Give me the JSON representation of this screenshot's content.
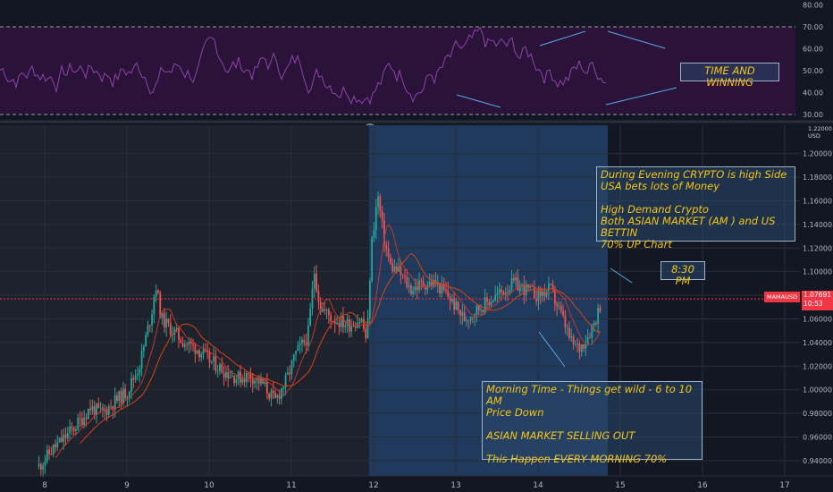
{
  "chart_data": [
    {
      "type": "line",
      "name": "oscillator",
      "y_ticks": [
        "80.00",
        "70.00",
        "60.00",
        "50.00",
        "40.00",
        "30.00"
      ],
      "upper_band": 70,
      "lower_band": 30,
      "ylim": [
        25,
        83
      ],
      "colors": {
        "line": "#8e44ad",
        "band_fill": "#2a1238",
        "band_line": "#9e9e9e"
      }
    },
    {
      "type": "candlestick",
      "name": "price",
      "currency": "USD",
      "y_ticks": [
        "1.22000",
        "1.20000",
        "1.18000",
        "1.16000",
        "1.14000",
        "1.12000",
        "1.10000",
        "1.08000",
        "1.06000",
        "1.04000",
        "1.02000",
        "1.00000",
        "0.98000",
        "0.96000",
        "0.94000"
      ],
      "ylim": [
        0.927,
        1.224
      ],
      "x_ticks": [
        "8",
        "9",
        "10",
        "11",
        "12",
        "13",
        "14",
        "15",
        "16",
        "17"
      ],
      "close_points": [
        [
          7.93,
          0.935
        ],
        [
          8.1,
          0.95
        ],
        [
          8.25,
          0.96
        ],
        [
          8.45,
          0.975
        ],
        [
          8.55,
          0.985
        ],
        [
          8.7,
          0.98
        ],
        [
          8.85,
          0.99
        ],
        [
          9.0,
          0.998
        ],
        [
          9.15,
          1.02
        ],
        [
          9.3,
          1.065
        ],
        [
          9.35,
          1.09
        ],
        [
          9.42,
          1.06
        ],
        [
          9.55,
          1.05
        ],
        [
          9.7,
          1.04
        ],
        [
          9.85,
          1.035
        ],
        [
          10.0,
          1.025
        ],
        [
          10.2,
          1.015
        ],
        [
          10.35,
          1.01
        ],
        [
          10.5,
          1.012
        ],
        [
          10.65,
          1.005
        ],
        [
          10.8,
          0.99
        ],
        [
          10.95,
          1.01
        ],
        [
          11.05,
          1.03
        ],
        [
          11.2,
          1.045
        ],
        [
          11.28,
          1.1
        ],
        [
          11.35,
          1.07
        ],
        [
          11.5,
          1.06
        ],
        [
          11.7,
          1.055
        ],
        [
          11.85,
          1.06
        ],
        [
          11.92,
          1.04
        ],
        [
          11.97,
          1.12
        ],
        [
          12.05,
          1.165
        ],
        [
          12.12,
          1.13
        ],
        [
          12.2,
          1.105
        ],
        [
          12.3,
          1.1
        ],
        [
          12.45,
          1.085
        ],
        [
          12.6,
          1.09
        ],
        [
          12.75,
          1.09
        ],
        [
          12.9,
          1.08
        ],
        [
          13.1,
          1.06
        ],
        [
          13.3,
          1.07
        ],
        [
          13.5,
          1.08
        ],
        [
          13.7,
          1.09
        ],
        [
          13.85,
          1.085
        ],
        [
          14.0,
          1.08
        ],
        [
          14.15,
          1.085
        ],
        [
          14.3,
          1.06
        ],
        [
          14.4,
          1.04
        ],
        [
          14.5,
          1.035
        ],
        [
          14.6,
          1.045
        ],
        [
          14.7,
          1.06
        ],
        [
          14.78,
          1.0769
        ]
      ],
      "current_price": "1.07691",
      "ticker_badge": "MAMAUSD",
      "countdown": "10:53",
      "colors": {
        "up": "#26a69a",
        "down": "#ef5350",
        "ma_fast": "#c0392b",
        "ma_slow": "#d84315",
        "highlight": "#1f3a5c"
      }
    }
  ],
  "annotations": {
    "time_and_winning": "TIME AND WINNING",
    "evening_note": "During Evening CRYPTO is high Side\nUSA bets lots of Money\n\nHigh Demand Crypto\nBoth ASIAN MARKET (AM ) and US BETTIN\n70% UP Chart",
    "time_label": "8:30 PM",
    "morning_note": "Morning Time - Things get wild - 6 to 10 AM\nPrice Down\n\nASIAN MARKET SELLING OUT\n\nThis Happen EVERY MORNING 70%"
  }
}
